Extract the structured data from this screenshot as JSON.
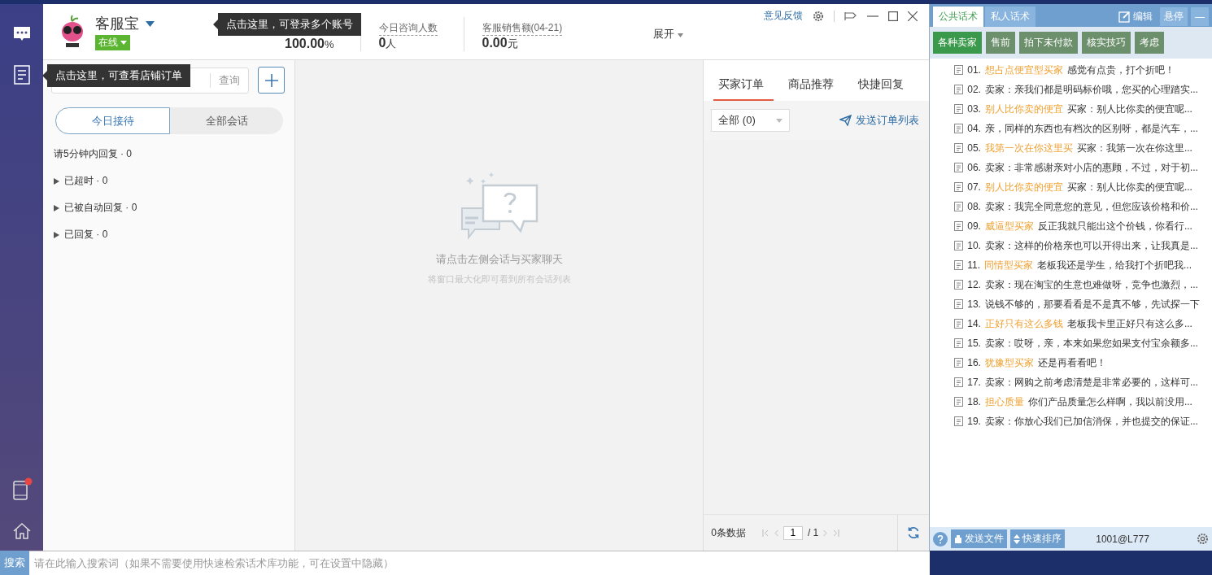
{
  "rail": {
    "items": [
      {
        "kind": "chat"
      },
      {
        "kind": "orders"
      },
      {
        "kind": "phone"
      },
      {
        "kind": "home"
      }
    ]
  },
  "header": {
    "account": "客服宝",
    "status": "在线",
    "stats": [
      {
        "value": "100.00",
        "unit": "%"
      },
      {
        "label": "今日咨询人数",
        "value": "0",
        "unit": "人"
      },
      {
        "label": "客服销售额(04-21)",
        "value": "0.00",
        "unit": "元"
      }
    ],
    "expand": "展开",
    "feedback": "意见反馈"
  },
  "tooltips": [
    {
      "kind": "account",
      "text": "点击这里，可登录多个账号"
    },
    {
      "kind": "orders",
      "text": "点击这里，可查看店铺订单"
    }
  ],
  "sessions": {
    "query_button": "查询",
    "tabs": [
      {
        "label": "今日接待",
        "selected": true
      },
      {
        "label": "全部会话",
        "selected": false
      }
    ],
    "notice": "请5分钟内回复 · 0",
    "groups": [
      {
        "label": "已超时 · 0",
        "expanded": false
      },
      {
        "label": "已被自动回复 · 0",
        "expanded": false
      },
      {
        "label": "已回复 · 0",
        "expanded": false
      }
    ]
  },
  "chat": {
    "empty_title": "请点击左侧会话与买家聊天",
    "empty_hint": "将窗口最大化即可看到所有会话列表"
  },
  "orders": {
    "tabs": [
      {
        "label": "买家订单",
        "selected": true
      },
      {
        "label": "商品推荐",
        "selected": false
      },
      {
        "label": "快捷回复",
        "selected": false
      }
    ],
    "filter": "全部 (0)",
    "send_link": "发送订单列表",
    "count": "0条数据",
    "page": "1",
    "pages": "/ 1"
  },
  "scripts": {
    "tabs": [
      {
        "label": "公共话术",
        "selected": true
      },
      {
        "label": "私人话术",
        "selected": false
      }
    ],
    "edit": "编辑",
    "pin": "悬停",
    "minimize": "—",
    "categories": [
      {
        "label": "各种卖家",
        "selected": true
      },
      {
        "label": "售前",
        "selected": false
      },
      {
        "label": "拍下未付款",
        "selected": false
      },
      {
        "label": "核实技巧",
        "selected": false
      },
      {
        "label": "考虑",
        "selected": false
      }
    ],
    "items": [
      {
        "number": "01.",
        "tag": "想占点便宜型买家",
        "text": "感觉有点贵，打个折吧！"
      },
      {
        "number": "02.",
        "text": "卖家：亲我们都是明码标价哦，您买的心理踏实..."
      },
      {
        "number": "03.",
        "tag": "别人比你卖的便宜",
        "text": "买家：别人比你卖的便宜呢..."
      },
      {
        "number": "04.",
        "text": "亲，同样的东西也有档次的区别呀，都是汽车，..."
      },
      {
        "number": "05.",
        "tag": "我第一次在你这里买",
        "text": "买家：我第一次在你这里..."
      },
      {
        "number": "06.",
        "text": "卖家：非常感谢亲对小店的惠顾，不过，对于初..."
      },
      {
        "number": "07.",
        "tag": "别人比你卖的便宜",
        "text": "买家：别人比你卖的便宜呢..."
      },
      {
        "number": "08.",
        "text": "卖家：我完全同意您的意见，但您应该价格和价..."
      },
      {
        "number": "09.",
        "tag": "威逼型买家",
        "text": "反正我就只能出这个价钱，你看行..."
      },
      {
        "number": "10.",
        "text": "卖家：这样的价格亲也可以开得出来，让我真是..."
      },
      {
        "number": "11.",
        "tag": "同情型买家",
        "text": "老板我还是学生，给我打个折吧我..."
      },
      {
        "number": "12.",
        "text": "卖家：现在淘宝的生意也难做呀，竞争也激烈，..."
      },
      {
        "number": "13.",
        "text": "说钱不够的，那要看看是不是真不够，先试探一下"
      },
      {
        "number": "14.",
        "tag": "正好只有这么多钱",
        "text": "老板我卡里正好只有这么多..."
      },
      {
        "number": "15.",
        "text": "卖家：哎呀，亲，本来如果您如果支付宝余额多..."
      },
      {
        "number": "16.",
        "tag": "犹豫型买家",
        "text": "还是再看看吧！"
      },
      {
        "number": "17.",
        "text": "卖家：网购之前考虑清楚是非常必要的，这样可..."
      },
      {
        "number": "18.",
        "tag": "担心质量",
        "text": "你们产品质量怎么样啊，我以前没用..."
      },
      {
        "number": "19.",
        "text": "卖家：你放心我们已加信消保，并也提交的保证..."
      }
    ],
    "send_file": "发送文件",
    "sort": "快速排序",
    "user": "1001@L777"
  },
  "search": {
    "label": "搜索",
    "placeholder": "请在此输入搜索词（如果不需要使用快速检索话术库功能，可在设置中隐藏）"
  }
}
